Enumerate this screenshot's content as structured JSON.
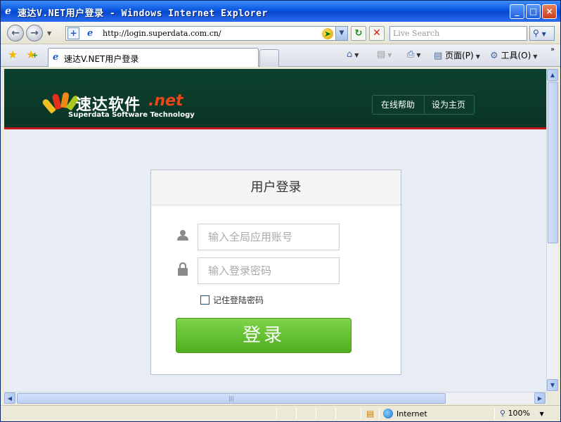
{
  "window": {
    "title": "速达V.NET用户登录 - Windows Internet Explorer",
    "minimize": "_",
    "maximize": "□",
    "close": "×"
  },
  "addressbar": {
    "url": "http://login.superdata.com.cn/",
    "search_placeholder": "Live Search"
  },
  "tabbar": {
    "active_tab": "速达V.NET用户登录",
    "home_label": "",
    "page_label": "页面(P)",
    "tools_label": "工具(O)"
  },
  "site": {
    "logo_text": "速达软件",
    "logo_net": ".net",
    "logo_sub": "Superdata  Software Technology",
    "nav": [
      {
        "label": "在线帮助"
      },
      {
        "label": "设为主页"
      }
    ],
    "header_bg": "#0d4030",
    "accent_red": "#c01818"
  },
  "login": {
    "title": "用户登录",
    "account_placeholder": "输入全局应用账号",
    "password_placeholder": "输入登录密码",
    "remember_label": "记住登陆密码",
    "submit_label": "登录",
    "button_color": "#5cb82a"
  },
  "statusbar": {
    "zone": "Internet",
    "zoom": "100%"
  }
}
